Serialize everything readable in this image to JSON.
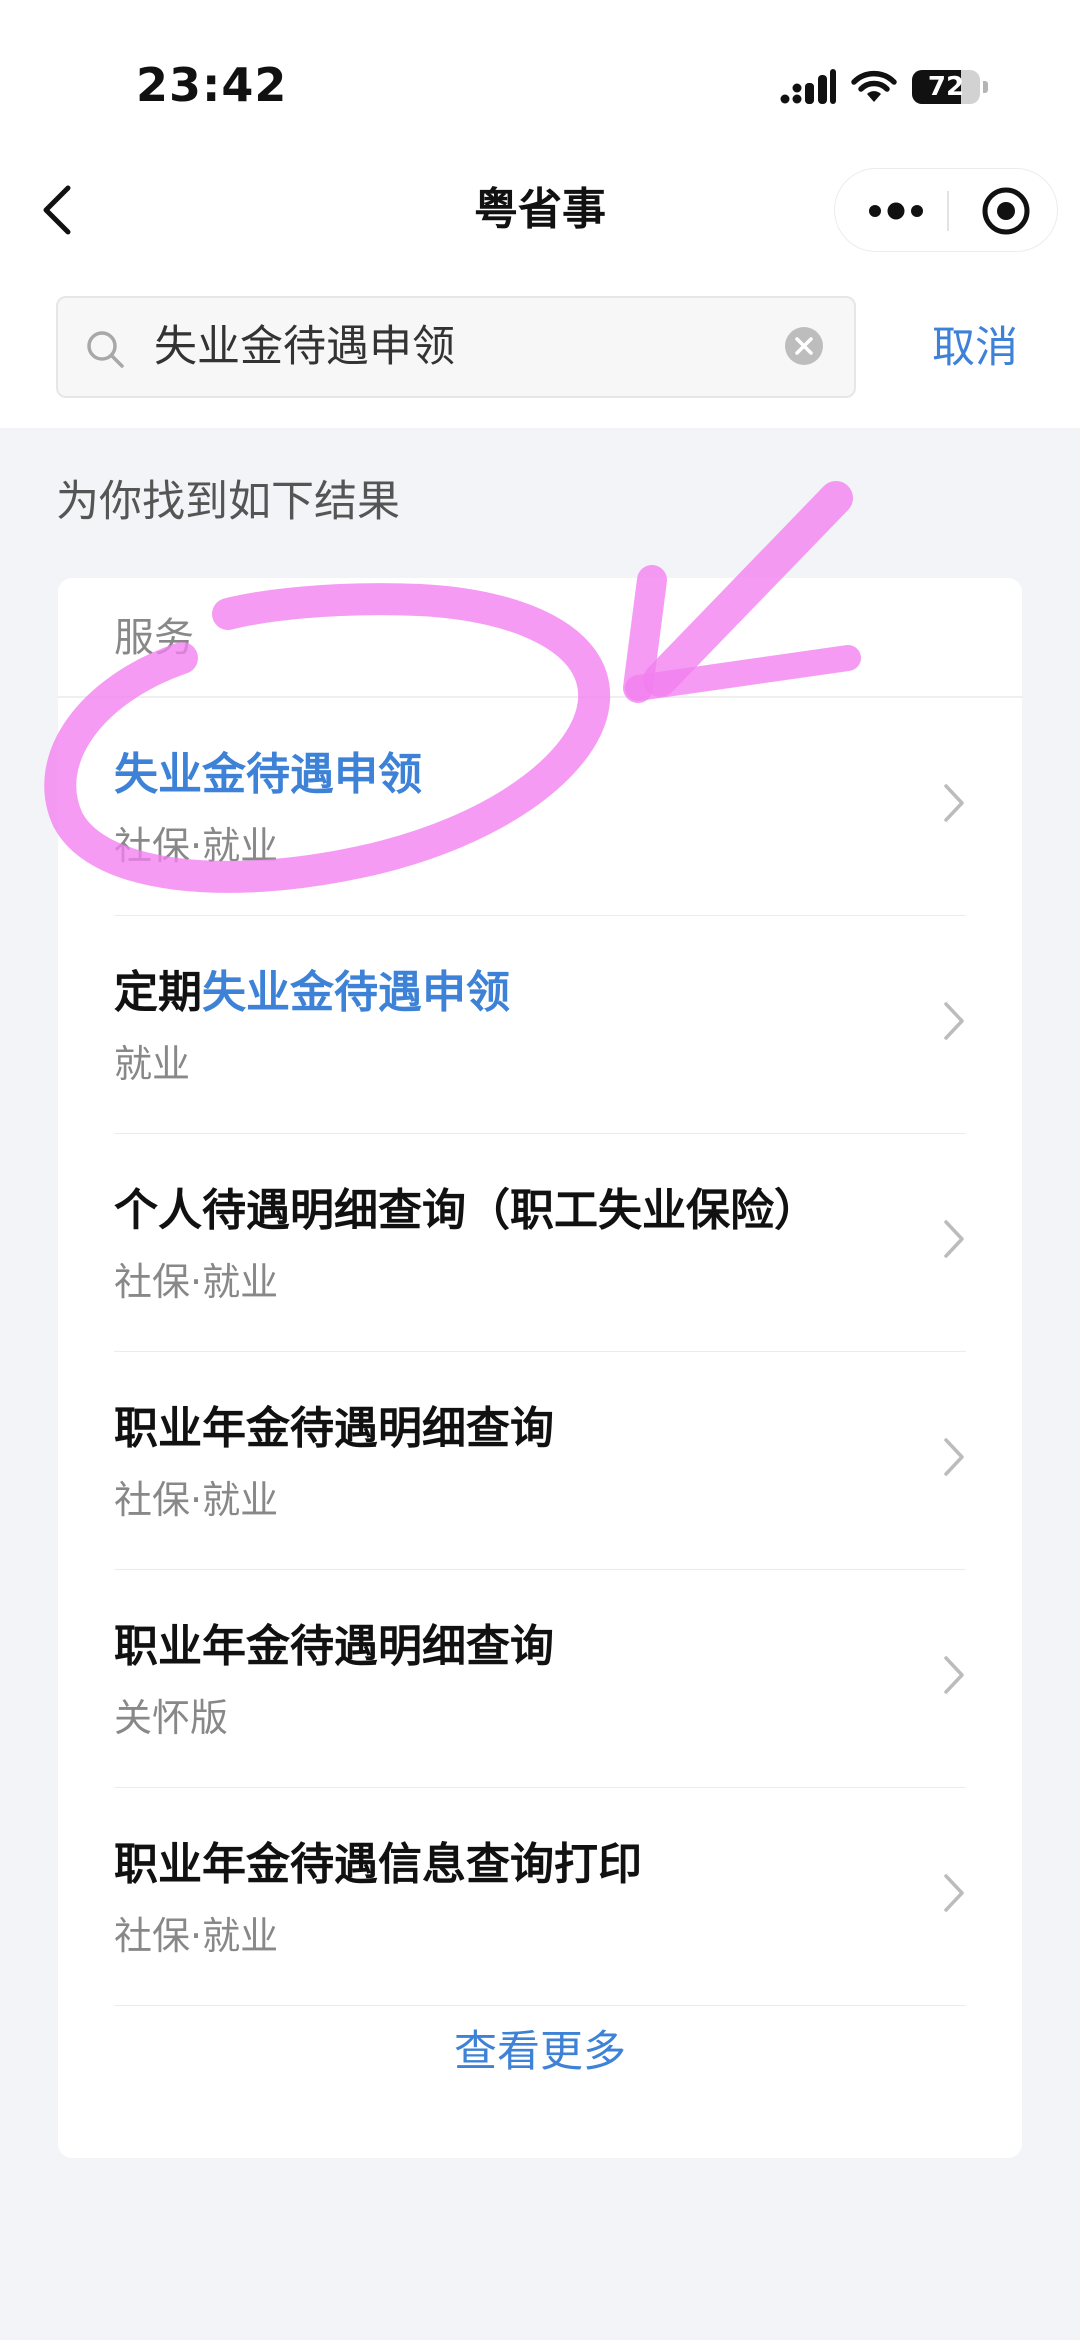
{
  "status_bar": {
    "time": "23:42",
    "battery_level": "72",
    "battery_fraction": 0.72,
    "icons": [
      "signal-icon",
      "wifi-icon",
      "battery-icon"
    ]
  },
  "nav": {
    "title": "粤省事",
    "back_icon": "chevron-left-icon",
    "more_icon": "more-dots-icon",
    "close_icon": "close-miniprogram-icon"
  },
  "search": {
    "value": "失业金待遇申领",
    "icon": "search-icon",
    "clear_icon": "clear-icon",
    "cancel_label": "取消"
  },
  "results": {
    "hint": "为你找到如下结果",
    "section_title": "服务",
    "items": [
      {
        "title_plain": "",
        "title_highlight": "失业金待遇申领",
        "subtitle": "社保·就业"
      },
      {
        "title_plain": "定期",
        "title_highlight": "失业金待遇申领",
        "subtitle": "就业"
      },
      {
        "title_plain": "个人待遇明细查询（职工失业保险）",
        "title_highlight": "",
        "subtitle": "社保·就业"
      },
      {
        "title_plain": "职业年金待遇明细查询",
        "title_highlight": "",
        "subtitle": "社保·就业"
      },
      {
        "title_plain": "职业年金待遇明细查询",
        "title_highlight": "",
        "subtitle": "关怀版"
      },
      {
        "title_plain": "职业年金待遇信息查询打印",
        "title_highlight": "",
        "subtitle": "社保·就业"
      }
    ],
    "more_label": "查看更多"
  },
  "colors": {
    "accent": "#3d82d6",
    "background": "#f3f4f7",
    "annotation": "#f27ff0"
  }
}
